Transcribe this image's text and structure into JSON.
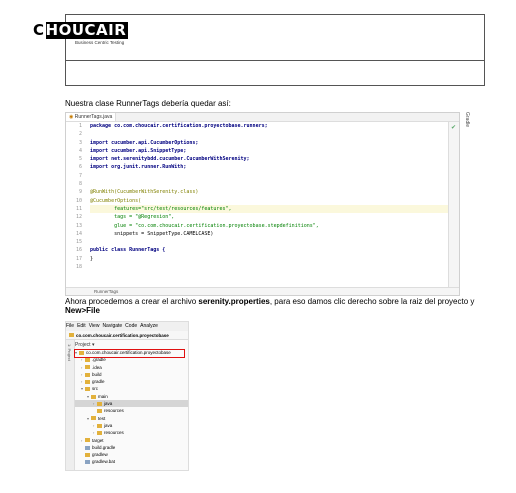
{
  "header": {
    "logo_first_letter": "C",
    "logo_rest": "HOUCAIR",
    "tagline": "Business Centric Testing"
  },
  "intro_paragraph": "Nuestra clase RunnerTags debería quedar así:",
  "editor": {
    "tab_label": "RunnerTags.java",
    "side_label": "Gradle",
    "status_text": "RunnerTags",
    "lines": [
      {
        "n": "1",
        "t": "package co.com.choucair.certification.proyectobase.runners;"
      },
      {
        "n": "2",
        "t": ""
      },
      {
        "n": "3",
        "t": "import cucumber.api.CucumberOptions;"
      },
      {
        "n": "4",
        "t": "import cucumber.api.SnippetType;"
      },
      {
        "n": "5",
        "t": "import net.serenitybdd.cucumber.CucumberWithSerenity;"
      },
      {
        "n": "6",
        "t": "import org.junit.runner.RunWith;"
      },
      {
        "n": "7",
        "t": ""
      },
      {
        "n": "8",
        "t": ""
      },
      {
        "n": "9",
        "t": "@RunWith(CucumberWithSerenity.class)"
      },
      {
        "n": "10",
        "t": "@CucumberOptions("
      },
      {
        "n": "11",
        "t": "        features=\"src/test/resources/features\","
      },
      {
        "n": "12",
        "t": "        tags = \"@Regresion\","
      },
      {
        "n": "13",
        "t": "        glue = \"co.com.choucair.certification.proyectobase.stepdefinitions\","
      },
      {
        "n": "14",
        "t": "        snippets = SnippetType.CAMELCASE)"
      },
      {
        "n": "15",
        "t": ""
      },
      {
        "n": "16",
        "t": "public class RunnerTags {"
      },
      {
        "n": "17",
        "t": "}"
      },
      {
        "n": "18",
        "t": ""
      }
    ]
  },
  "instruction": {
    "prefix": "Ahora procedemos a crear el archivo ",
    "bold_file": "serenity.properties",
    "middle": ",  para eso damos clic derecho sobre la raiz del proyecto y ",
    "bold_action": "New>File"
  },
  "ide": {
    "menu": [
      "File",
      "Edit",
      "View",
      "Navigate",
      "Code",
      "Analyze"
    ],
    "breadcrumb": "co.com.choucair.certification.proyectobase",
    "side_label": "1: Project",
    "project_header": "Project ▾",
    "tree": [
      {
        "label": "co.com.choucair.certification.proyectobase",
        "indent": 0,
        "arrow": "▾",
        "highlight": true
      },
      {
        "label": ".gradle",
        "indent": 1,
        "arrow": "›"
      },
      {
        "label": ".idea",
        "indent": 1,
        "arrow": "›"
      },
      {
        "label": "build",
        "indent": 1,
        "arrow": "›"
      },
      {
        "label": "gradle",
        "indent": 1,
        "arrow": "›"
      },
      {
        "label": "src",
        "indent": 1,
        "arrow": "▾"
      },
      {
        "label": "main",
        "indent": 2,
        "arrow": "▾"
      },
      {
        "label": "java",
        "indent": 3,
        "arrow": "›",
        "selected": true
      },
      {
        "label": "resources",
        "indent": 3,
        "arrow": ""
      },
      {
        "label": "test",
        "indent": 2,
        "arrow": "▾"
      },
      {
        "label": "java",
        "indent": 3,
        "arrow": "›"
      },
      {
        "label": "resources",
        "indent": 3,
        "arrow": "›"
      },
      {
        "label": "target",
        "indent": 1,
        "arrow": "›"
      },
      {
        "label": "build.gradle",
        "indent": 1,
        "arrow": ""
      },
      {
        "label": "gradlew",
        "indent": 1,
        "arrow": ""
      },
      {
        "label": "gradlew.bat",
        "indent": 1,
        "arrow": ""
      }
    ]
  },
  "colors": {
    "highlight_box": "#e01010",
    "folder": "#e2b13c"
  }
}
